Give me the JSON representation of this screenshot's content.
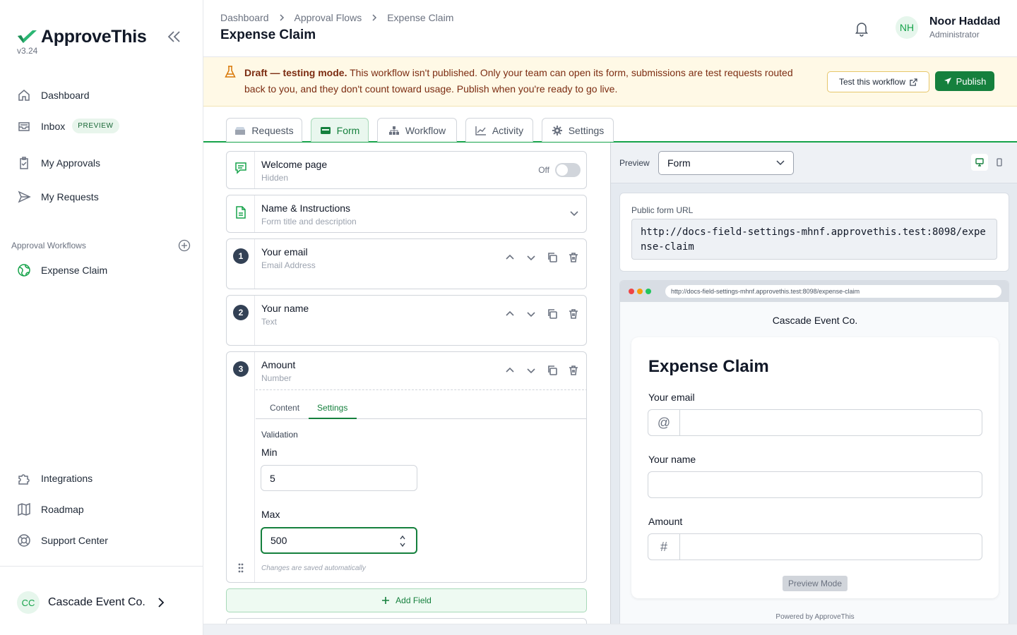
{
  "app": {
    "name": "ApproveThis",
    "version": "v3.24"
  },
  "sidebar": {
    "nav": [
      {
        "label": "Dashboard"
      },
      {
        "label": "Inbox",
        "badge": "PREVIEW"
      },
      {
        "label": "My Approvals"
      },
      {
        "label": "My Requests"
      }
    ],
    "workflows_label": "Approval Workflows",
    "workflows": [
      {
        "label": "Expense Claim"
      }
    ],
    "bottom_nav": [
      {
        "label": "Integrations"
      },
      {
        "label": "Roadmap"
      },
      {
        "label": "Support Center"
      }
    ],
    "org": {
      "initials": "CC",
      "name": "Cascade Event Co."
    }
  },
  "header": {
    "breadcrumbs": [
      "Dashboard",
      "Approval Flows",
      "Expense Claim"
    ],
    "title": "Expense Claim",
    "user": {
      "initials": "NH",
      "name": "Noor Haddad",
      "role": "Administrator"
    }
  },
  "banner": {
    "strong": "Draft — testing mode.",
    "text": " This workflow isn't published. Only your team can open its form, submissions are test requests routed back to you, and they don't count toward usage. Publish when you're ready to go live.",
    "test_label": "Test this workflow",
    "publish_label": "Publish"
  },
  "tabs": [
    {
      "label": "Requests"
    },
    {
      "label": "Form",
      "active": true
    },
    {
      "label": "Workflow"
    },
    {
      "label": "Activity"
    },
    {
      "label": "Settings"
    }
  ],
  "editor": {
    "welcome": {
      "title": "Welcome page",
      "sub": "Hidden",
      "toggle_label": "Off"
    },
    "name": {
      "title": "Name & Instructions",
      "sub": "Form title and description"
    },
    "fields": [
      {
        "num": "1",
        "title": "Your email",
        "type": "Email Address"
      },
      {
        "num": "2",
        "title": "Your name",
        "type": "Text"
      },
      {
        "num": "3",
        "title": "Amount",
        "type": "Number"
      }
    ],
    "subtabs": [
      "Content",
      "Settings"
    ],
    "validation_label": "Validation",
    "min_label": "Min",
    "min_value": "5",
    "max_label": "Max",
    "max_value": "500",
    "autosave": "Changes are saved automatically",
    "add_field": "Add Field"
  },
  "preview": {
    "label": "Preview",
    "select_value": "Form",
    "url_label": "Public form URL",
    "url": "http://docs-field-settings-mhnf.approvethis.test:8098/expense-claim",
    "browser_url": "http://docs-field-settings-mhnf.approvethis.test:8098/expense-claim",
    "company": "Cascade Event Co.",
    "form_title": "Expense Claim",
    "fields": [
      {
        "label": "Your email",
        "prefix": "@"
      },
      {
        "label": "Your name",
        "prefix": ""
      },
      {
        "label": "Amount",
        "prefix": "#"
      }
    ],
    "mode_label": "Preview Mode",
    "powered": "Powered by ApproveThis"
  },
  "colors": {
    "brand": "#16a34a",
    "brand_dark": "#15803d",
    "banner_bg": "#fff9e6",
    "banner_text": "#7c2d12"
  }
}
